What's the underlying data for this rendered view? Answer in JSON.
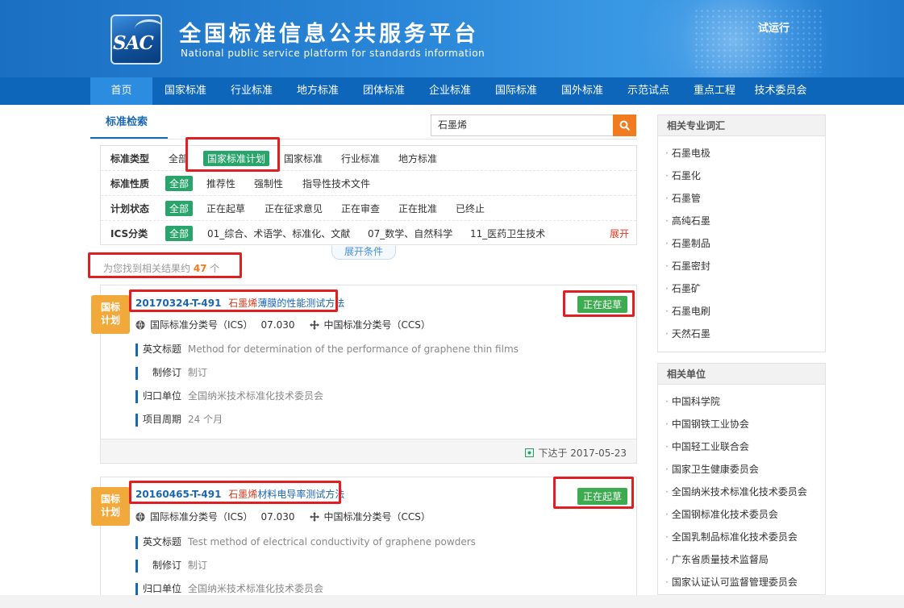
{
  "header": {
    "logo_text": "SAC",
    "title": "全国标准信息公共服务平台",
    "subtitle": "National public service platform  for standards information",
    "trial": "试运行"
  },
  "nav": [
    "首页",
    "国家标准",
    "行业标准",
    "地方标准",
    "团体标准",
    "企业标准",
    "国际标准",
    "国外标准",
    "示范试点",
    "重点工程",
    "技术委员会"
  ],
  "search": {
    "tab": "标准检索",
    "query": "石墨烯"
  },
  "filters": {
    "type": {
      "label": "标准类型",
      "options": [
        "全部",
        "国家标准计划",
        "国家标准",
        "行业标准",
        "地方标准"
      ]
    },
    "nature": {
      "label": "标准性质",
      "options": [
        "全部",
        "推荐性",
        "强制性",
        "指导性技术文件"
      ]
    },
    "plan_status": {
      "label": "计划状态",
      "options": [
        "全部",
        "正在起草",
        "正在征求意见",
        "正在审查",
        "正在批准",
        "已终止"
      ]
    },
    "ics": {
      "label": "ICS分类",
      "options": [
        "全部",
        "01_综合、术语学、标准化、文献",
        "07_数学、自然科学",
        "11_医药卫生技术"
      ],
      "expand": "展开"
    },
    "expand_conditions": "展开条件"
  },
  "result_count": {
    "prefix": "为您找到相关结果约 ",
    "count": "47",
    "suffix": " 个"
  },
  "results": [
    {
      "badge": "国标\n计划",
      "code": "20170324-T-491",
      "name_red": "石墨烯",
      "name_rest": "薄膜的性能测试方法",
      "status": "正在起草",
      "ics_label": "国际标准分类号（ICS）",
      "ics": "07.030",
      "ccs_label": "中国标准分类号（CCS）",
      "en_title_label": "英文标题",
      "en_title": "Method for determination of the performance of graphene thin films",
      "revision_label": "制修订",
      "revision": "制订",
      "unit_label": "归口单位",
      "unit": "全国纳米技术标准化技术委员会",
      "cycle_label": "项目周期",
      "cycle": "24 个月",
      "issued": "下达于 2017-05-23"
    },
    {
      "badge": "国标\n计划",
      "code": "20160465-T-491",
      "name_red": "石墨烯",
      "name_rest": "材料电导率测试方法",
      "status": "正在起草",
      "ics_label": "国际标准分类号（ICS）",
      "ics": "07.030",
      "ccs_label": "中国标准分类号（CCS）",
      "en_title_label": "英文标题",
      "en_title": "Test method of electrical conductivity of graphene powders",
      "revision_label": "制修订",
      "revision": "制订",
      "unit_label": "归口单位",
      "unit": "全国纳米技术标准化技术委员会"
    }
  ],
  "sidebar": {
    "terms_title": "相关专业词汇",
    "terms": [
      "石墨电极",
      "石墨化",
      "石墨管",
      "高纯石墨",
      "石墨制品",
      "石墨密封",
      "石墨矿",
      "石墨电刷",
      "天然石墨"
    ],
    "units_title": "相关单位",
    "units": [
      "中国科学院",
      "中国钢铁工业协会",
      "中国轻工业联合会",
      "国家卫生健康委员会",
      "全国纳米技术标准化技术委员会",
      "全国钢标准化技术委员会",
      "全国乳制品标准化技术委员会",
      "广东省质量技术监督局",
      "国家认证认可监督管理委员会"
    ]
  },
  "colors": {
    "nav": "#0d66ba",
    "accent_green": "#27a56b",
    "accent_orange": "#f17b1f",
    "badge": "#f2a93b",
    "highlight_red": "#e02020"
  }
}
